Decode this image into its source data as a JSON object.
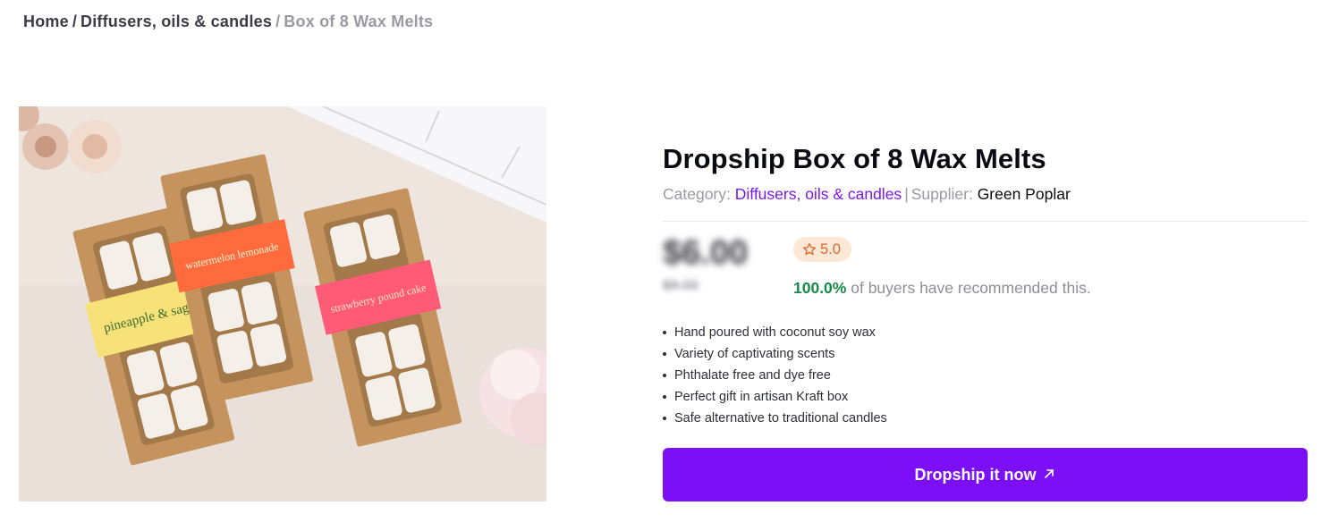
{
  "breadcrumb": {
    "home": "Home",
    "separator": "/",
    "category": "Diffusers, oils & candles",
    "current": "Box of 8 Wax Melts"
  },
  "product": {
    "title": "Dropship Box of 8 Wax Melts",
    "category_label": "Category:",
    "category": "Diffusers, oils & candles",
    "divider": "|",
    "supplier_label": "Supplier:",
    "supplier": "Green Poplar",
    "price": "$6.00",
    "old_price": "$8.00",
    "rating": "5.0",
    "recommend_pct": "100.0%",
    "recommend_text": "of buyers have recommended this.",
    "features": [
      "Hand poured with coconut soy wax",
      "Variety of captivating scents",
      "Phthalate free and dye free",
      "Perfect gift in artisan Kraft box",
      "Safe alternative to traditional candles"
    ],
    "cta_label": "Dropship it now",
    "image_labels": {
      "box1": "pineapple & sage",
      "box2": "watermelon lemonade",
      "box3": "strawberry pound cake"
    }
  },
  "colors": {
    "accent": "#7b0ff5",
    "category_link": "#7b16ee",
    "success": "#168a4a",
    "rating_bg": "#fde8d7",
    "rating_fg": "#d56a2c"
  },
  "icons": {
    "rating": "star-outline-icon",
    "cta": "arrow-up-right-icon"
  }
}
